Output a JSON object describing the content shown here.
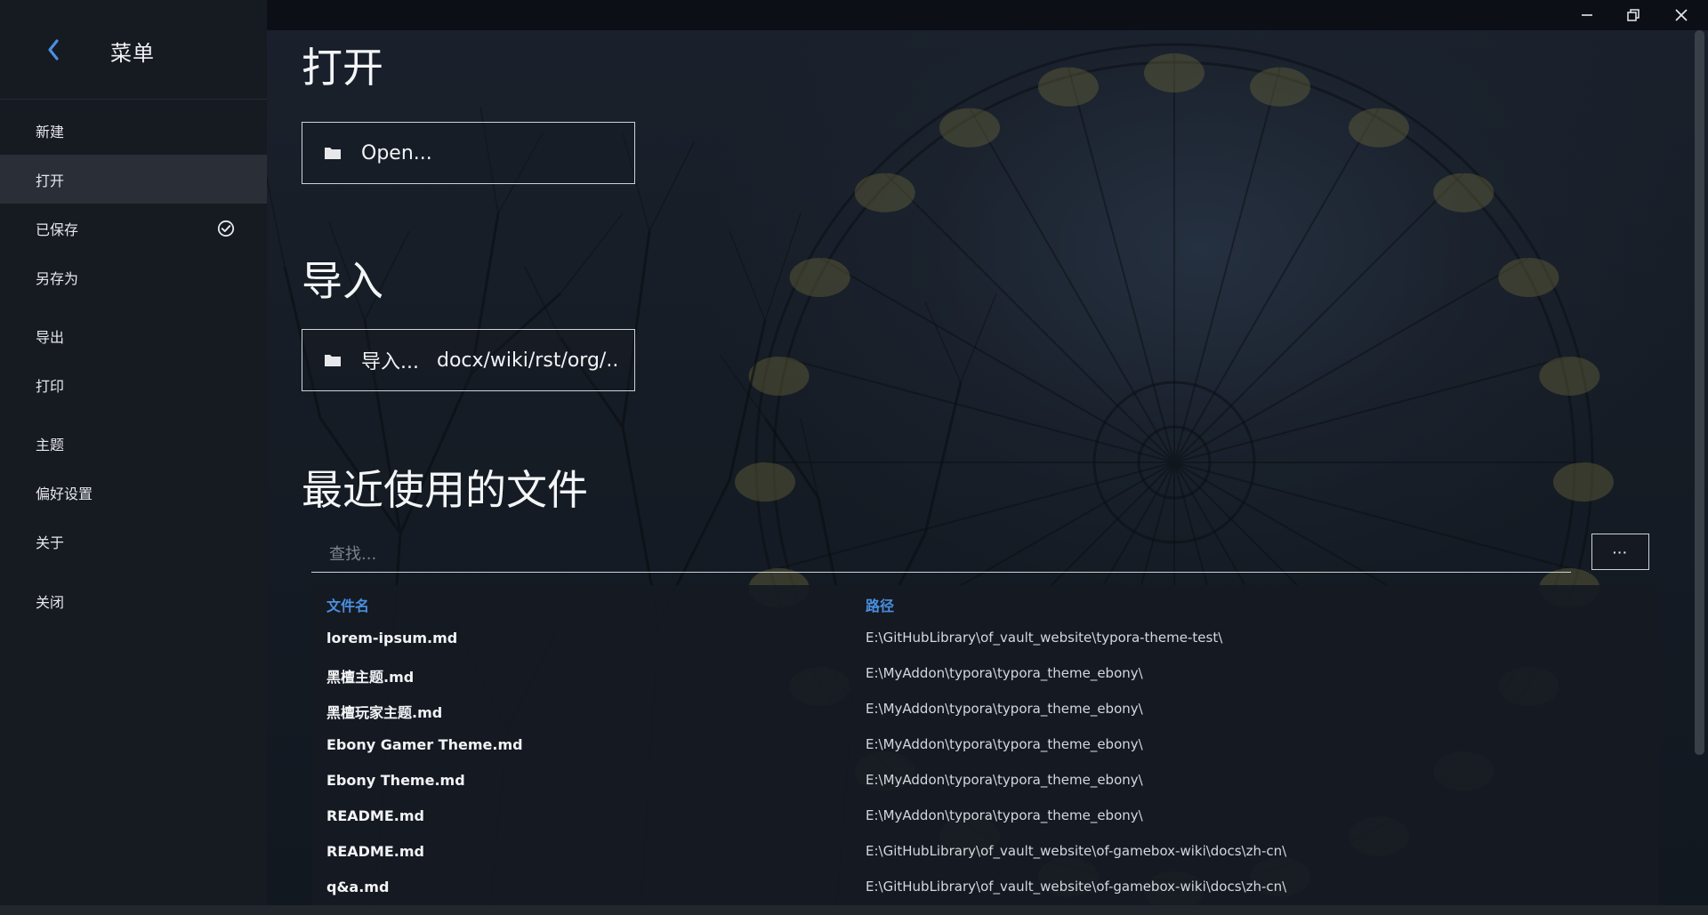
{
  "window": {
    "minimize_icon": "minimize-icon",
    "restore_icon": "restore-icon",
    "close_icon": "close-icon"
  },
  "sidebar": {
    "title": "菜单",
    "back_icon": "chevron-left-icon",
    "items": [
      {
        "label": "新建",
        "active": false
      },
      {
        "label": "打开",
        "active": true
      },
      {
        "label": "已保存",
        "active": false,
        "icon": "check-circle-icon"
      },
      {
        "label": "另存为",
        "active": false
      },
      {
        "label": "导出",
        "active": false
      },
      {
        "label": "打印",
        "active": false
      },
      {
        "label": "主题",
        "active": false
      },
      {
        "label": "偏好设置",
        "active": false
      },
      {
        "label": "关于",
        "active": false
      },
      {
        "label": "关闭",
        "active": false
      }
    ]
  },
  "main": {
    "open_section": {
      "title": "打开",
      "button_label": "Open...",
      "icon": "folder-icon"
    },
    "import_section": {
      "title": "导入",
      "button_label": "导入...",
      "button_ext": "docx/wiki/rst/org/..",
      "icon": "folder-icon"
    },
    "recent_section": {
      "title": "最近使用的文件",
      "search_placeholder": "查找...",
      "search_value": "",
      "more_label": "···",
      "columns": {
        "name": "文件名",
        "path": "路径"
      },
      "rows": [
        {
          "name": "lorem-ipsum.md",
          "path": "E:\\GitHubLibrary\\of_vault_website\\typora-theme-test\\"
        },
        {
          "name": "黑檀主题.md",
          "path": "E:\\MyAddon\\typora\\typora_theme_ebony\\"
        },
        {
          "name": "黑檀玩家主题.md",
          "path": "E:\\MyAddon\\typora\\typora_theme_ebony\\"
        },
        {
          "name": "Ebony Gamer Theme.md",
          "path": "E:\\MyAddon\\typora\\typora_theme_ebony\\"
        },
        {
          "name": "Ebony Theme.md",
          "path": "E:\\MyAddon\\typora\\typora_theme_ebony\\"
        },
        {
          "name": "README.md",
          "path": "E:\\MyAddon\\typora\\typora_theme_ebony\\"
        },
        {
          "name": "README.md",
          "path": "E:\\GitHubLibrary\\of_vault_website\\of-gamebox-wiki\\docs\\zh-cn\\"
        },
        {
          "name": "q&a.md",
          "path": "E:\\GitHubLibrary\\of_vault_website\\of-gamebox-wiki\\docs\\zh-cn\\"
        }
      ]
    }
  },
  "colors": {
    "accent": "#4a8fe0",
    "sidebar_bg": "#161a21",
    "active_item_bg": "#2a2f37",
    "main_bg": "#161c25"
  }
}
